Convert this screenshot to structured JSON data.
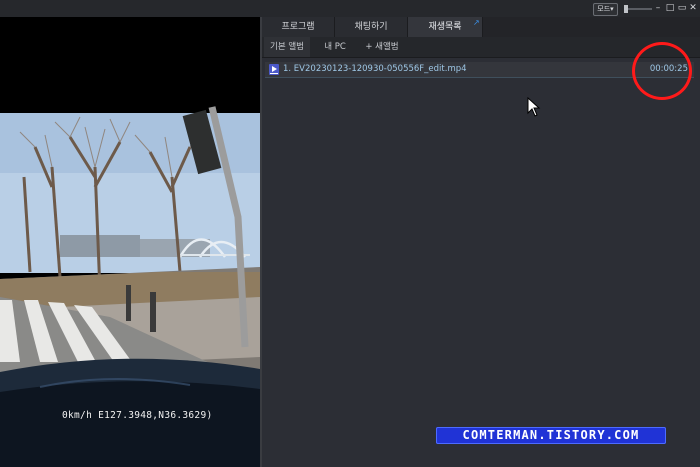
{
  "titlebar": {
    "mode_label": "모드▾",
    "minimize_icon": "minimize-icon",
    "maximize_icon": "maximize-icon",
    "close_icon": "close-icon",
    "minimize_glyph": "–",
    "maximize_glyph": "□",
    "close_glyph": "✕"
  },
  "video": {
    "osd_text": "0km/h  E127.3948,N36.3629)"
  },
  "panel": {
    "tabs": [
      {
        "label": "프로그램"
      },
      {
        "label": "채팅하기"
      },
      {
        "label": "재생목록"
      }
    ],
    "active_tab_index": 2,
    "subtabs": [
      {
        "label": "기본 앨범"
      },
      {
        "label": "내 PC"
      },
      {
        "label": "+ 새앨범"
      }
    ],
    "playlist": [
      {
        "title": "1. EV20230123-120930-050556F_edit.mp4",
        "duration": "00:00:25"
      }
    ]
  },
  "annotation": {
    "color": "#ff1a1a"
  },
  "watermark": {
    "text": "COMTERMAN.TISTORY.COM"
  },
  "colors": {
    "accent": "#3a8ee6",
    "highlight_text": "#9ec7e6",
    "watermark_bg": "#2033d6"
  }
}
